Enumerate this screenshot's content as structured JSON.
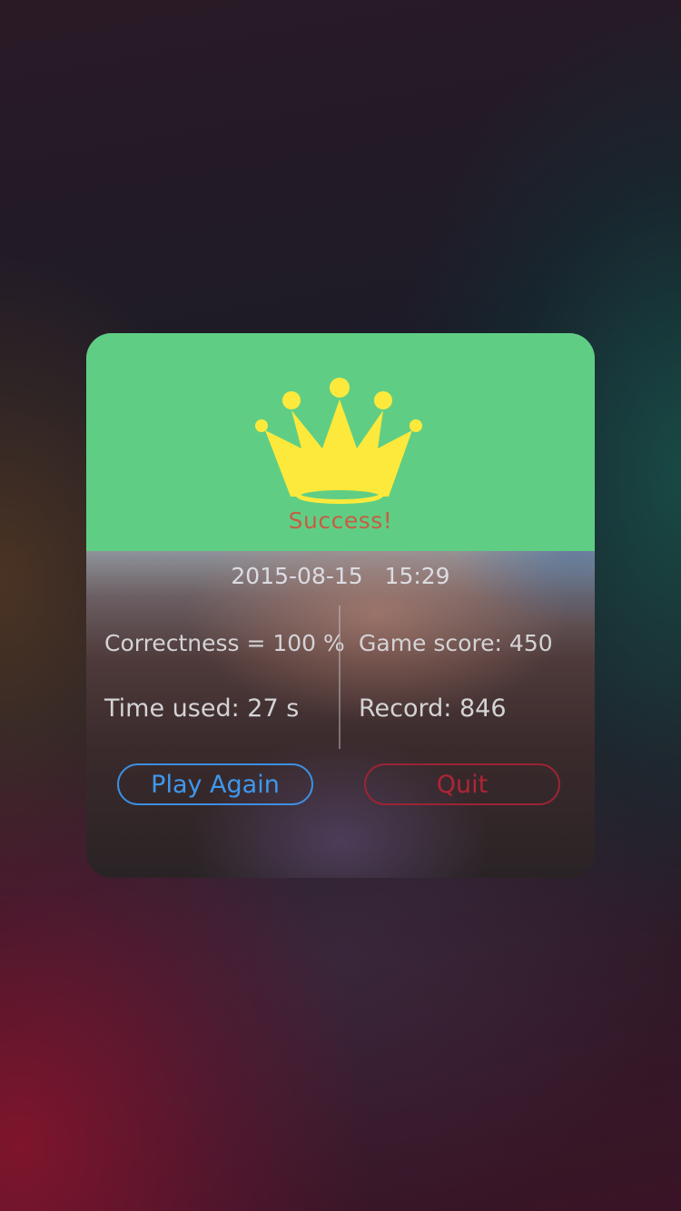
{
  "result": {
    "title": "Success!",
    "datetime": "2015-08-15   15:29",
    "correctness": "Correctness = 100 %",
    "game_score": "Game score: 450",
    "time_used": "Time used: 27 s",
    "record": "Record: 846"
  },
  "buttons": {
    "play_again": "Play Again",
    "quit": "Quit"
  },
  "icons": {
    "crown": "crown-icon"
  },
  "colors": {
    "header_green": "#5fce84",
    "crown_yellow": "#fde93c",
    "success_text": "#c75d43",
    "play_again": "#3f98ee",
    "quit": "#b02437"
  }
}
